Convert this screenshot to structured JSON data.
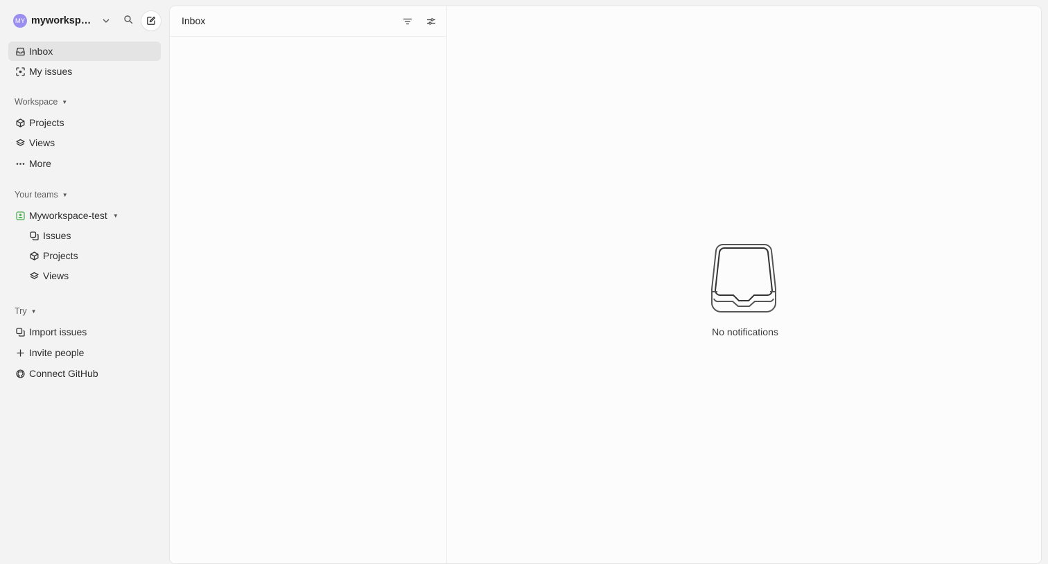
{
  "workspace": {
    "avatar_initials": "MY",
    "name": "myworkspac...",
    "avatar_color": "#9a8ff0"
  },
  "icons": {
    "search": "search-icon",
    "new_issue": "compose-icon",
    "chevron": "chevron-down-icon",
    "filter": "filter-icon",
    "display_options": "sliders-icon",
    "empty_inbox": "inbox-tray-icon"
  },
  "sidebar": {
    "top_items": [
      {
        "label": "Inbox",
        "icon": "inbox-icon",
        "active": true
      },
      {
        "label": "My issues",
        "icon": "target-icon",
        "active": false
      }
    ],
    "workspace_section": {
      "label": "Workspace",
      "items": [
        {
          "label": "Projects",
          "icon": "cube-icon"
        },
        {
          "label": "Views",
          "icon": "layers-icon"
        },
        {
          "label": "More",
          "icon": "ellipsis-icon"
        }
      ]
    },
    "teams_section": {
      "label": "Your teams",
      "team": {
        "label": "Myworkspace-test",
        "icon": "team-icon",
        "color": "#4caf50"
      },
      "items": [
        {
          "label": "Issues",
          "icon": "issues-icon"
        },
        {
          "label": "Projects",
          "icon": "cube-icon"
        },
        {
          "label": "Views",
          "icon": "layers-icon"
        }
      ]
    },
    "try_section": {
      "label": "Try",
      "items": [
        {
          "label": "Import issues",
          "icon": "import-icon"
        },
        {
          "label": "Invite people",
          "icon": "plus-icon"
        },
        {
          "label": "Connect GitHub",
          "icon": "github-icon"
        }
      ]
    }
  },
  "inbox": {
    "title": "Inbox",
    "empty_text": "No notifications"
  },
  "colors": {
    "sidebar_bg": "#f3f3f3",
    "panel_bg": "#fcfcfc",
    "active_item_bg": "#e4e4e4"
  }
}
